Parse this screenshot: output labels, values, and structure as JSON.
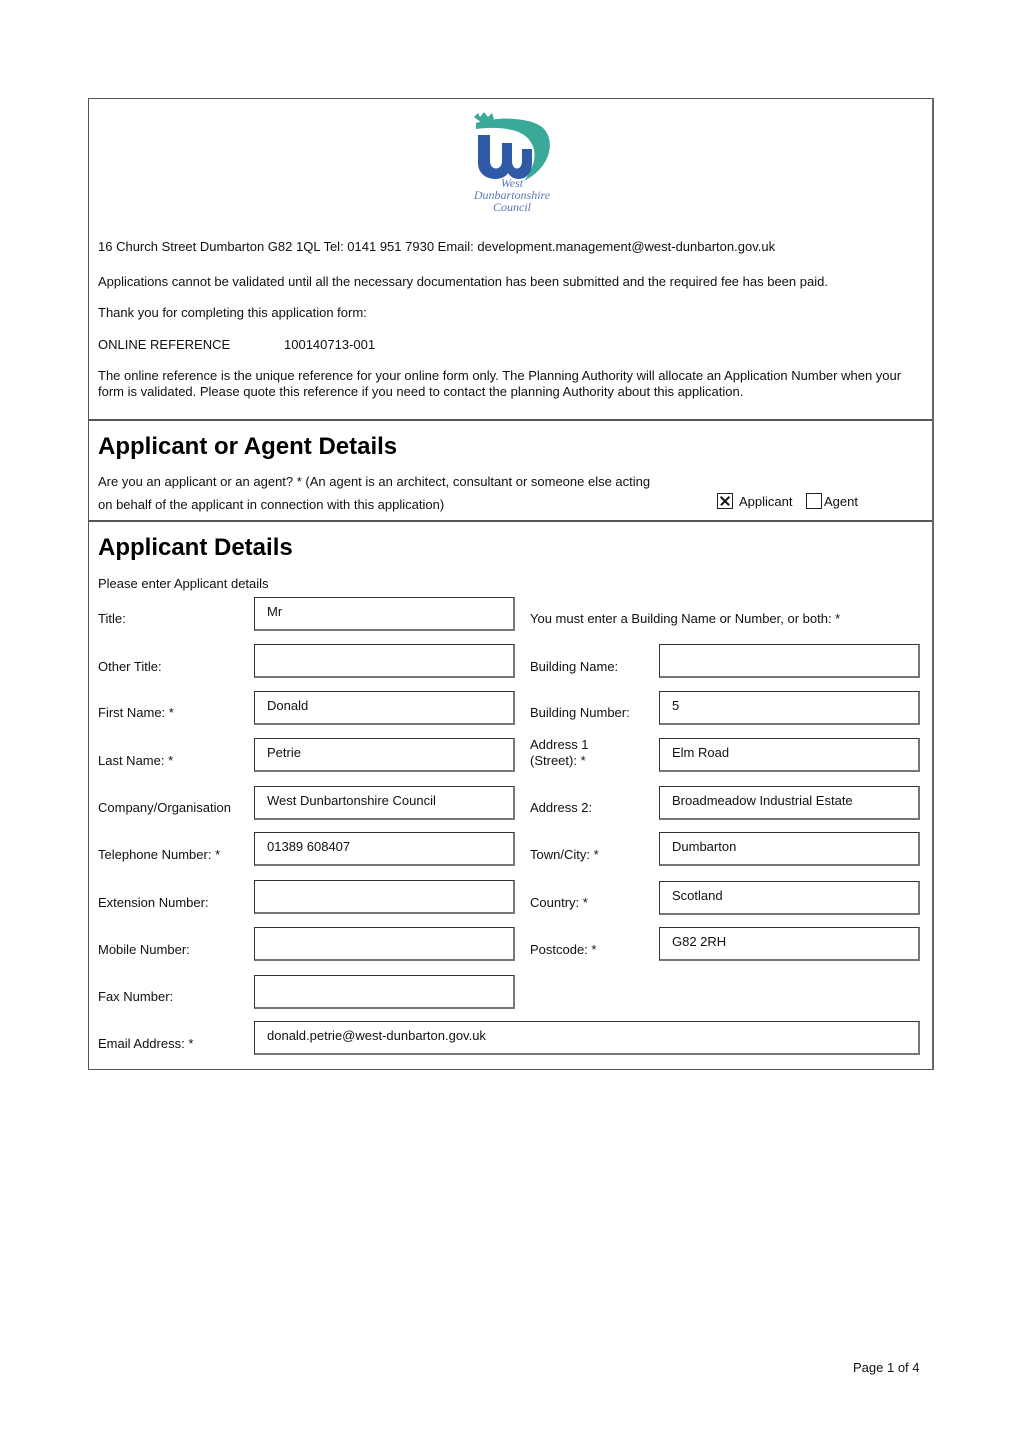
{
  "header": {
    "logo": {
      "name": "west-dunbartonshire-council-logo",
      "text_lines": [
        "West",
        "Dunbartonshire",
        "Council"
      ],
      "colors": {
        "blue": "#2f5aa8",
        "teal": "#3aa99a",
        "text": "#5a78b8"
      }
    },
    "contact_line": "16 Church Street Dumbarton G82 1QL  Tel: 0141 951 7930  Email: development.management@west-dunbarton.gov.uk",
    "validation_notice": "Applications cannot be validated until all the necessary documentation has been submitted and the required fee has been paid.",
    "thank_you": "Thank you for completing this application form:",
    "online_reference_label": "ONLINE REFERENCE",
    "online_reference_value": "100140713-001",
    "reference_notice": "The online reference is the unique reference for your online form only. The  Planning Authority will allocate an Application Number when your form is validated. Please quote this reference if you need to contact the planning Authority about this application."
  },
  "agent_section": {
    "title": "Applicant or Agent Details",
    "question_line1": "Are you an applicant or an agent? * (An agent is an architect, consultant or someone else acting",
    "question_line2": "on behalf of the applicant in connection with this application)",
    "options": [
      {
        "label": "Applicant",
        "checked": true
      },
      {
        "label": "Agent",
        "checked": false
      }
    ]
  },
  "applicant_section": {
    "title": "Applicant Details",
    "instruction": "Please enter Applicant details",
    "building_note": "You must enter a Building Name or Number, or both: *",
    "left_fields": [
      {
        "label": "Title:",
        "value": "Mr"
      },
      {
        "label": "Other Title:",
        "value": ""
      },
      {
        "label": "First Name: *",
        "value": "Donald"
      },
      {
        "label": "Last Name: *",
        "value": "Petrie"
      },
      {
        "label": "Company/Organisation",
        "value": "West Dunbartonshire Council"
      },
      {
        "label": "Telephone Number: *",
        "value": "01389 608407"
      },
      {
        "label": "Extension Number:",
        "value": ""
      },
      {
        "label": "Mobile Number:",
        "value": ""
      },
      {
        "label": "Fax Number:",
        "value": ""
      }
    ],
    "right_fields": [
      {
        "label": "Building Name:",
        "value": ""
      },
      {
        "label": "Building Number:",
        "value": "5"
      },
      {
        "label_line1": "Address 1",
        "label_line2": "(Street): *",
        "value": "Elm Road"
      },
      {
        "label": "Address 2:",
        "value": "Broadmeadow Industrial Estate"
      },
      {
        "label": "Town/City: *",
        "value": "Dumbarton"
      },
      {
        "label": "Country: *",
        "value": "Scotland"
      },
      {
        "label": "Postcode: *",
        "value": "G82 2RH"
      }
    ],
    "email": {
      "label": "Email Address: *",
      "value": "donald.petrie@west-dunbarton.gov.uk"
    }
  },
  "footer": {
    "page_indicator": "Page 1 of 4"
  }
}
